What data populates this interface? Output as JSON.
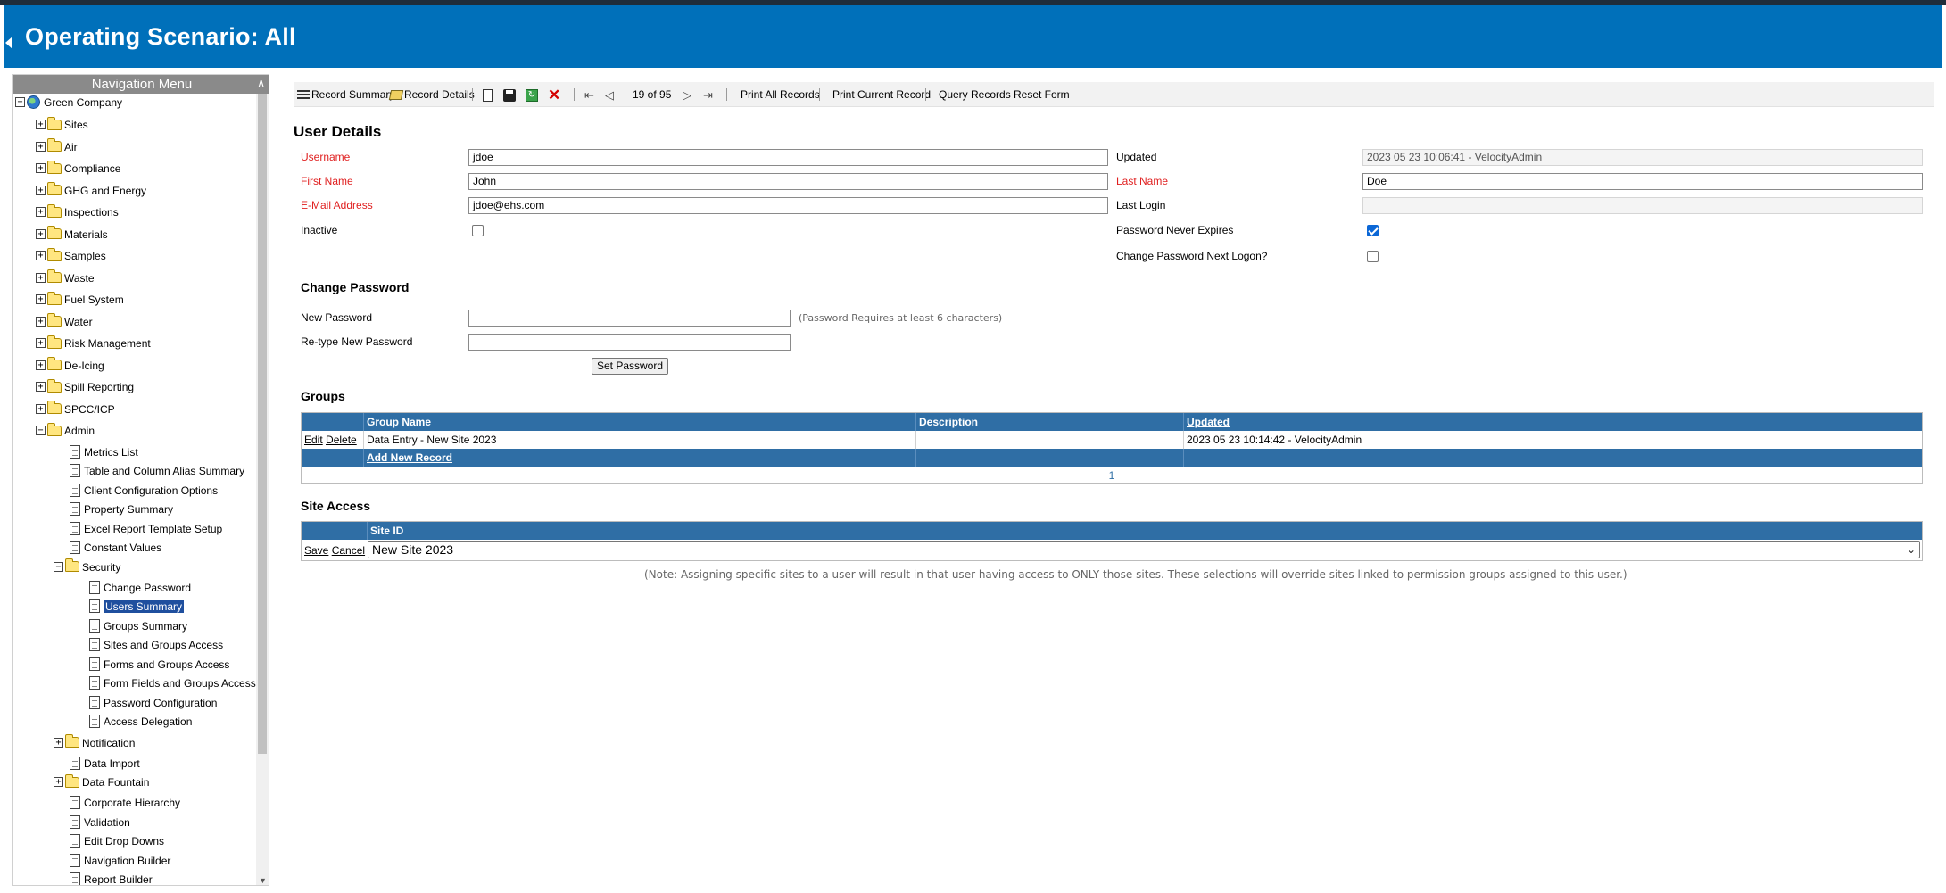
{
  "header": {
    "title": "Operating Scenario: All"
  },
  "nav": {
    "title": "Navigation Menu",
    "root": "Green Company",
    "top_items": [
      "Sites",
      "Air",
      "Compliance",
      "GHG and Energy",
      "Inspections",
      "Materials",
      "Samples",
      "Waste",
      "Fuel System",
      "Water",
      "Risk Management",
      "De-Icing",
      "Spill Reporting",
      "SPCC/ICP",
      "Admin"
    ],
    "admin_items": [
      "Metrics List",
      "Table and Column Alias Summary",
      "Client Configuration Options",
      "Property Summary",
      "Excel Report Template Setup",
      "Constant Values"
    ],
    "security": "Security",
    "security_items": [
      "Change Password",
      "Users Summary",
      "Groups Summary",
      "Sites and Groups Access",
      "Forms and Groups Access",
      "Form Fields and Groups Access",
      "Password Configuration",
      "Access Delegation"
    ],
    "after_items": [
      "Notification",
      "Data Import",
      "Data Fountain",
      "Corporate Hierarchy",
      "Validation",
      "Edit Drop Downs",
      "Navigation Builder",
      "Report Builder"
    ],
    "selected": "Users Summary"
  },
  "toolbar": {
    "record_summary": "Record Summary",
    "record_details": "Record Details",
    "record_counter": "19 of 95",
    "print_all": "Print All Records",
    "print_current": "Print Current Record",
    "query": "Query Records",
    "reset": "Reset Form"
  },
  "user": {
    "title": "User Details",
    "username_label": "Username",
    "username": "jdoe",
    "first_name_label": "First Name",
    "first_name": "John",
    "email_label": "E-Mail Address",
    "email": "jdoe@ehs.com",
    "inactive_label": "Inactive",
    "inactive": false,
    "updated_label": "Updated",
    "updated": "2023 05 23 10:06:41 - VelocityAdmin",
    "last_name_label": "Last Name",
    "last_name": "Doe",
    "last_login_label": "Last Login",
    "last_login": "",
    "pw_never_expires_label": "Password Never Expires",
    "pw_never_expires": true,
    "change_pw_next_label": "Change Password Next Logon?",
    "change_pw_next": false
  },
  "change_password": {
    "title": "Change Password",
    "new_label": "New Password",
    "retype_label": "Re-type New Password",
    "hint": "(Password Requires at least 6 characters)",
    "button": "Set Password"
  },
  "groups": {
    "title": "Groups",
    "columns": [
      "Group Name",
      "Description",
      "Updated"
    ],
    "rows": [
      {
        "edit": "Edit",
        "delete": "Delete",
        "group_name": "Data Entry - New Site 2023",
        "description": "",
        "updated": "2023 05 23 10:14:42 - VelocityAdmin"
      }
    ],
    "add_new": "Add New Record",
    "page": "1"
  },
  "site_access": {
    "title": "Site Access",
    "column": "Site ID",
    "save": "Save",
    "cancel": "Cancel",
    "selected_site": "New Site 2023",
    "note": "(Note: Assigning specific sites to a user will result in that user having access to ONLY those sites. These selections will override sites linked to permission groups assigned to this user.)"
  }
}
